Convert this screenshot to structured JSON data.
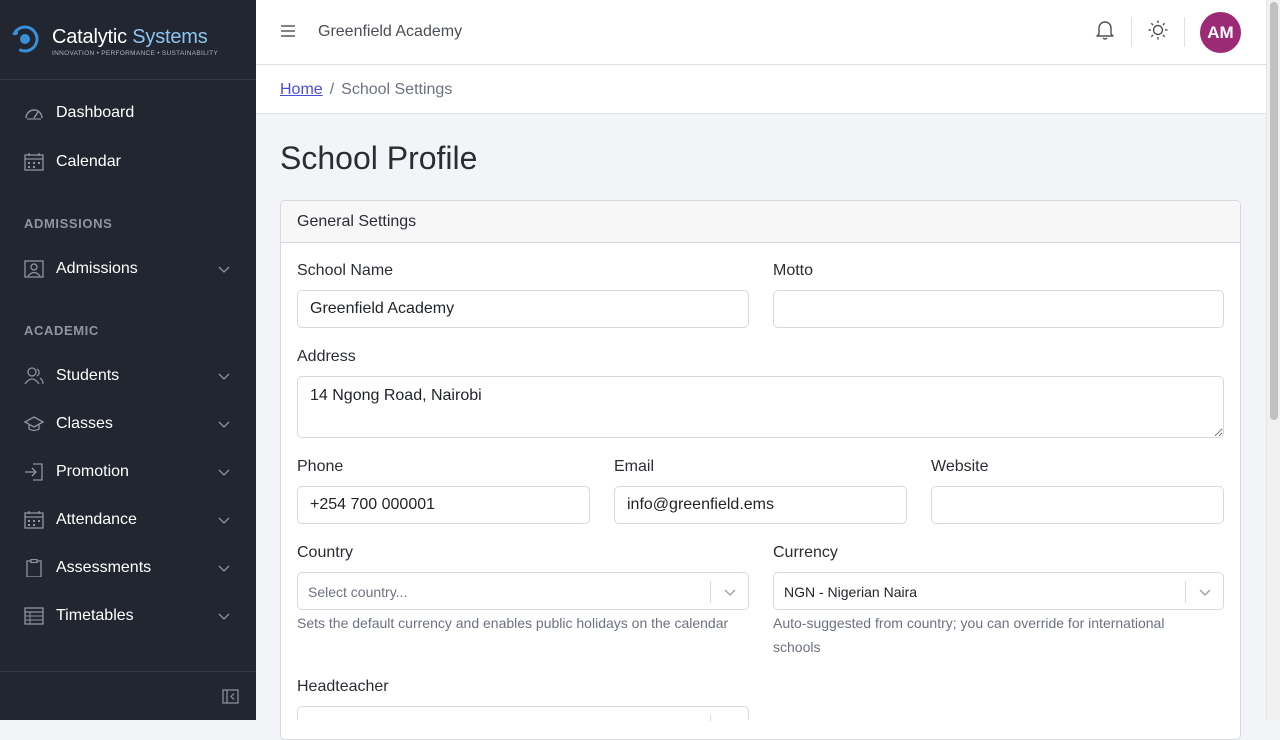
{
  "brand": {
    "name_part1": "Catalytic",
    "name_part2": "Systems",
    "tagline": "INNOVATION • PERFORMANCE • SUSTAINABILITY"
  },
  "sidebar": {
    "items": [
      {
        "label": "Dashboard",
        "icon": "speedometer-icon"
      },
      {
        "label": "Calendar",
        "icon": "calendar-icon"
      }
    ],
    "sections": [
      {
        "title": "ADMISSIONS",
        "items": [
          {
            "label": "Admissions",
            "icon": "contact-card-icon"
          }
        ]
      },
      {
        "title": "ACADEMIC",
        "items": [
          {
            "label": "Students",
            "icon": "people-icon"
          },
          {
            "label": "Classes",
            "icon": "graduation-cap-icon"
          },
          {
            "label": "Promotion",
            "icon": "arrow-into-box-icon"
          },
          {
            "label": "Attendance",
            "icon": "calendar-icon"
          },
          {
            "label": "Assessments",
            "icon": "clipboard-icon"
          },
          {
            "label": "Timetables",
            "icon": "table-icon"
          }
        ]
      }
    ]
  },
  "header": {
    "title": "Greenfield Academy",
    "avatar_initials": "AM"
  },
  "breadcrumb": {
    "home": "Home",
    "current": "School Settings"
  },
  "page": {
    "title": "School Profile",
    "card_title": "General Settings"
  },
  "form": {
    "school_name": {
      "label": "School Name",
      "value": "Greenfield Academy"
    },
    "motto": {
      "label": "Motto",
      "value": ""
    },
    "address": {
      "label": "Address",
      "value": "14 Ngong Road, Nairobi"
    },
    "phone": {
      "label": "Phone",
      "value": "+254 700 000001"
    },
    "email": {
      "label": "Email",
      "value": "info@greenfield.ems"
    },
    "website": {
      "label": "Website",
      "value": ""
    },
    "country": {
      "label": "Country",
      "placeholder": "Select country...",
      "help": "Sets the default currency and enables public holidays on the calendar"
    },
    "currency": {
      "label": "Currency",
      "value": "NGN - Nigerian Naira",
      "help": "Auto-suggested from country; you can override for international schools"
    },
    "headteacher": {
      "label": "Headteacher"
    }
  },
  "colors": {
    "sidebar_bg": "#212631",
    "avatar_bg": "#9c2a74",
    "link": "#4c4dd6",
    "brand_accent": "#8ec4f0"
  }
}
